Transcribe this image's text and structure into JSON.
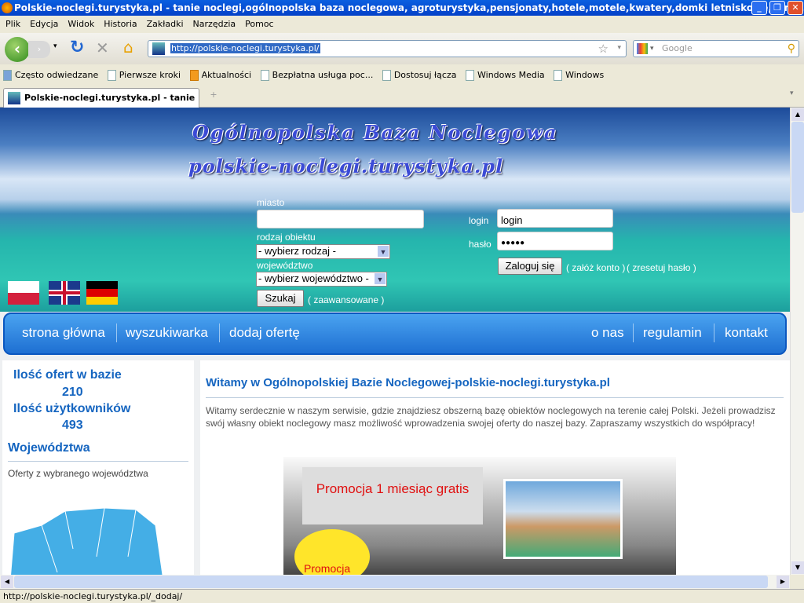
{
  "window": {
    "title": "Polskie-noclegi.turystyka.pl - tanie noclegi,ogólnopolska baza noclegowa, agroturystyka,pensjonaty,hotele,motele,kwatery,domki letniskowe,kemp..."
  },
  "menu": [
    "Plik",
    "Edycja",
    "Widok",
    "Historia",
    "Zakładki",
    "Narzędzia",
    "Pomoc"
  ],
  "toolbar": {
    "url": "http://polskie-noclegi.turystyka.pl/",
    "search_placeholder": "Google"
  },
  "bookmarks": [
    "Często odwiedzane",
    "Pierwsze kroki",
    "Aktualności",
    "Bezpłatna usługa poc...",
    "Dostosuj łącza",
    "Windows Media",
    "Windows"
  ],
  "tab": {
    "label": "Polskie-noclegi.turystyka.pl - tanie n..."
  },
  "banner": {
    "title1": "Ogólnopolska Baza Noclegowa",
    "title2": "polskie-noclegi.turystyka.pl"
  },
  "search_form": {
    "city_label": "miasto",
    "city_value": "",
    "type_label": "rodzaj obiektu",
    "type_value": "- wybierz rodzaj -",
    "region_label": "województwo",
    "region_value": "- wybierz województwo -",
    "search_button": "Szukaj",
    "advanced_link": "( zaawansowane )"
  },
  "login_form": {
    "login_label": "login",
    "login_value": "login",
    "password_label": "hasło",
    "password_value": "●●●●●",
    "login_button": "Zaloguj się",
    "register_link": "( załóż konto )",
    "reset_link": "( zresetuj hasło )"
  },
  "nav": {
    "left": [
      "strona główna",
      "wyszukiwarka",
      "dodaj ofertę"
    ],
    "right": [
      "o nas",
      "regulamin",
      "kontakt"
    ]
  },
  "sidebar": {
    "offers_label": "Ilość ofert w bazie",
    "offers_count": "210",
    "users_label": "Ilość użytkowników",
    "users_count": "493",
    "regions_heading": "Województwa",
    "regions_text": "Oferty z wybranego województwa"
  },
  "main": {
    "heading": "Witamy w Ogólnopolskiej Bazie Noclegowej-polskie-noclegi.turystyka.pl",
    "intro": "Witamy serdecznie w naszym serwisie, gdzie znajdziesz obszerną bazę obiektów noclegowych na terenie całej Polski. Jeżeli prowadzisz swój własny obiekt noclegowy masz możliwość wprowadzenia swojej oferty do naszej bazy. Zapraszamy wszystkich do współpracy!",
    "promo_title": "Promocja 1 miesiąc gratis",
    "promo_badge": "Promocja"
  },
  "status": {
    "text": "http://polskie-noclegi.turystyka.pl/_dodaj/"
  }
}
